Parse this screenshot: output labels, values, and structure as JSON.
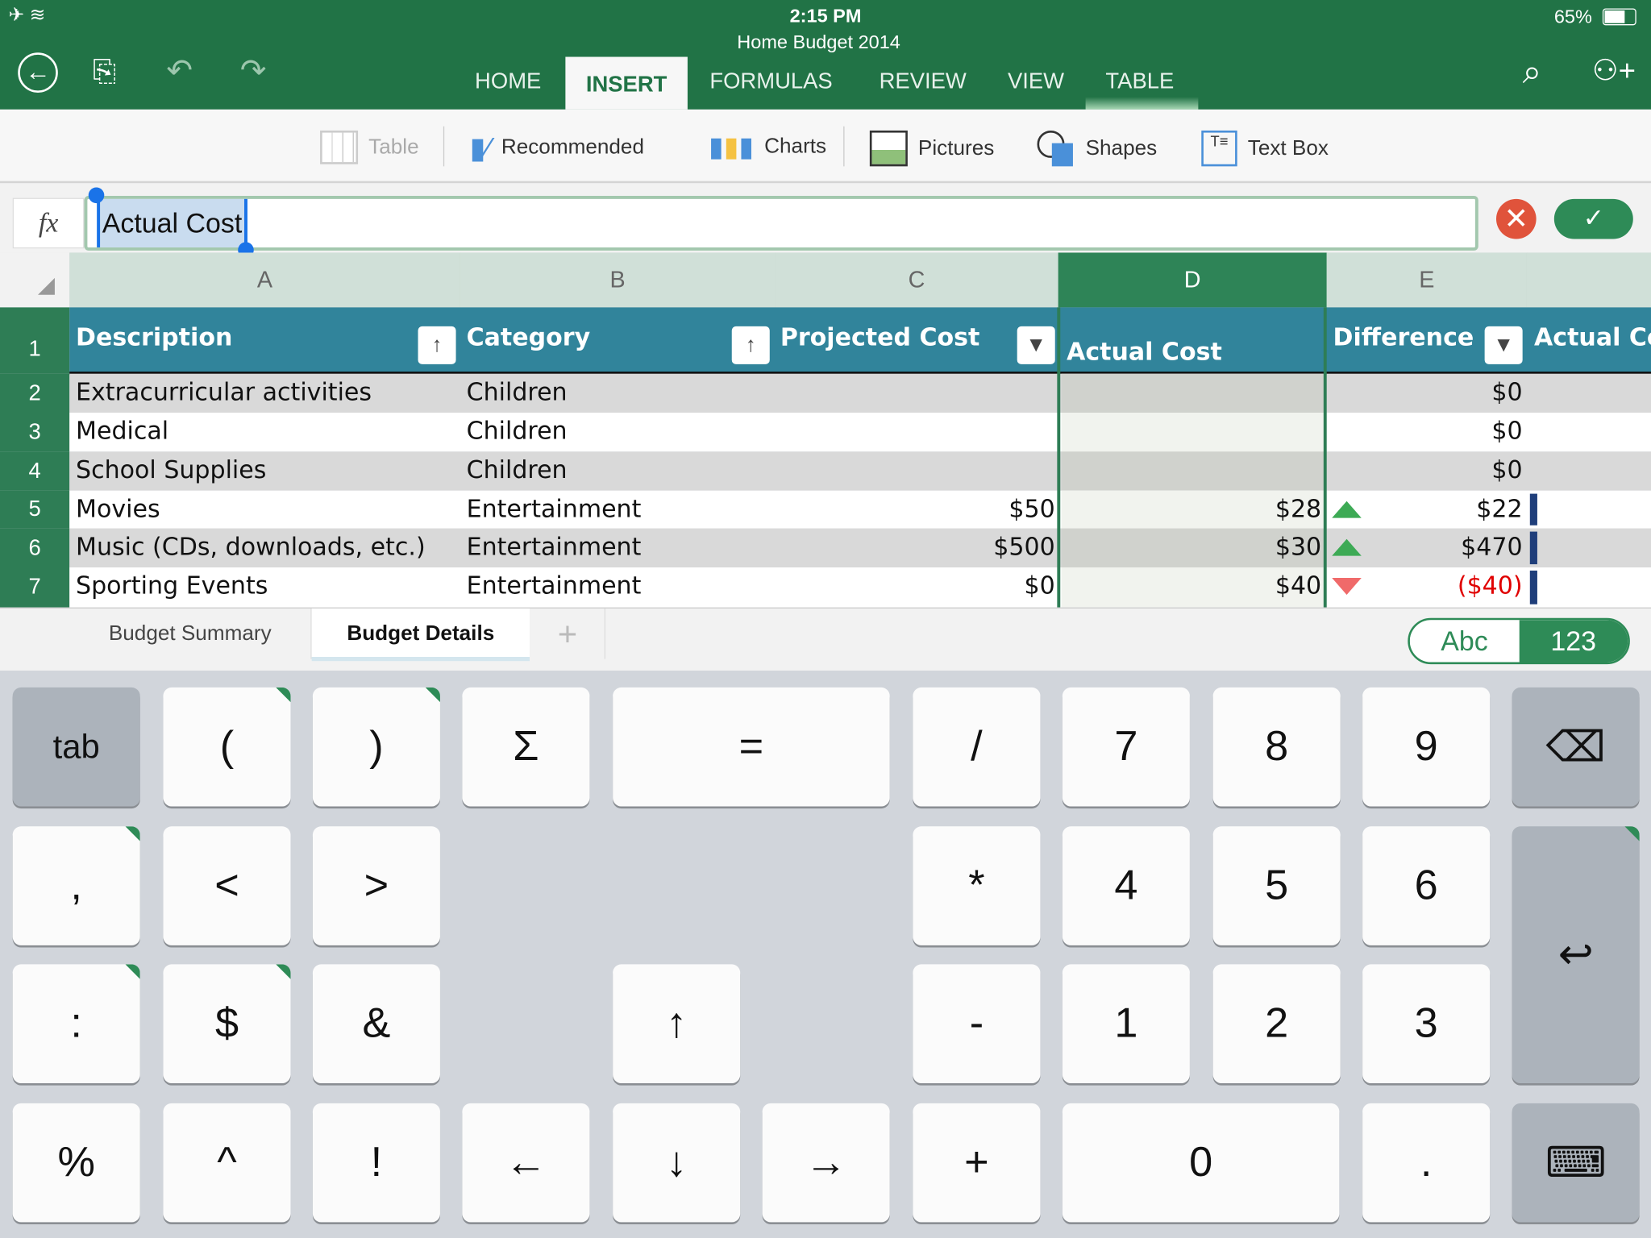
{
  "status": {
    "time": "2:15 PM",
    "battery": "65%",
    "doc_title": "Home Budget 2014"
  },
  "tabs": [
    "HOME",
    "INSERT",
    "FORMULAS",
    "REVIEW",
    "VIEW",
    "TABLE"
  ],
  "active_tab": "INSERT",
  "ribbon": {
    "table": "Table",
    "recommended": "Recommended",
    "charts": "Charts",
    "pictures": "Pictures",
    "shapes": "Shapes",
    "textbox": "Text Box"
  },
  "formula": {
    "fx": "fx",
    "value": "Actual Cost"
  },
  "columns": [
    "A",
    "B",
    "C",
    "D",
    "E"
  ],
  "row_numbers": [
    "1",
    "2",
    "3",
    "4",
    "5",
    "6",
    "7"
  ],
  "table_headers": [
    "Description",
    "Category",
    "Projected Cost",
    "Actual Cost",
    "Difference",
    "Actual Cos"
  ],
  "rows": [
    {
      "desc": "Extracurricular activities",
      "cat": "Children",
      "proj": "",
      "actual": "",
      "diff": "$0",
      "trend": ""
    },
    {
      "desc": "Medical",
      "cat": "Children",
      "proj": "",
      "actual": "",
      "diff": "$0",
      "trend": ""
    },
    {
      "desc": "School Supplies",
      "cat": "Children",
      "proj": "",
      "actual": "",
      "diff": "$0",
      "trend": ""
    },
    {
      "desc": "Movies",
      "cat": "Entertainment",
      "proj": "$50",
      "actual": "$28",
      "diff": "$22",
      "trend": "up"
    },
    {
      "desc": "Music (CDs, downloads, etc.)",
      "cat": "Entertainment",
      "proj": "$500",
      "actual": "$30",
      "diff": "$470",
      "trend": "up"
    },
    {
      "desc": "Sporting Events",
      "cat": "Entertainment",
      "proj": "$0",
      "actual": "$40",
      "diff": "($40)",
      "trend": "down"
    }
  ],
  "sheets": [
    "Budget Summary",
    "Budget Details"
  ],
  "active_sheet": "Budget Details",
  "kb_mode": {
    "abc": "Abc",
    "num": "123"
  },
  "colors": {
    "brand": "#217346",
    "table_header": "#31849b",
    "negative": "#e00000"
  },
  "keys": [
    [
      "tab",
      "(",
      ")",
      "Σ",
      "=",
      "/",
      "7",
      "8",
      "9",
      "backspace"
    ],
    [
      ",",
      "<",
      ">",
      "*",
      "4",
      "5",
      "6",
      "return"
    ],
    [
      ":",
      "$",
      "&",
      "↑",
      "-",
      "1",
      "2",
      "3"
    ],
    [
      "%",
      "^",
      "!",
      "←",
      "↓",
      "→",
      "+",
      "0",
      ".",
      "hide-keyboard"
    ]
  ]
}
